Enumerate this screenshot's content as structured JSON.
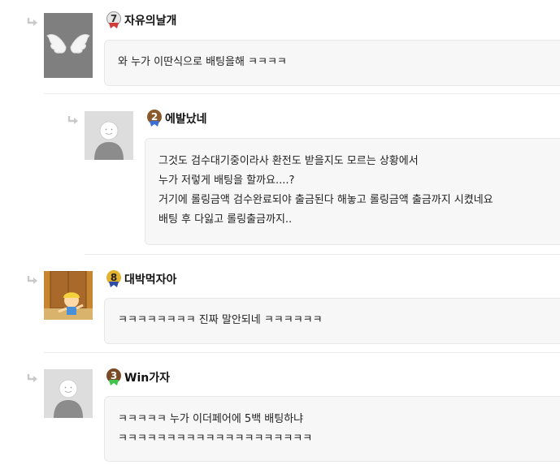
{
  "comments": [
    {
      "nickname": "자유의날개",
      "level": "7",
      "level_color": "#7b7b7b",
      "avatar": "white-wings",
      "lines": [
        "와 누가 이딴식으로 배팅을해 ㅋㅋㅋㅋ"
      ]
    },
    {
      "nickname": "에발났네",
      "level": "2",
      "level_color": "#8a5a2b",
      "avatar": "default-user",
      "lines": [
        "그것도 검수대기중이라사 환전도 받을지도 모르는 상황에서",
        "누가 저렇게 배팅을 할까요....?",
        "거기에 롤링금액 검수완료되야 출금된다 해놓고 롤링금액 출금까지 시켰네요",
        "배팅 후 다잃고 롤링출금까지.."
      ]
    },
    {
      "nickname": "대박먹자아",
      "level": "8",
      "level_color": "#c9a227",
      "avatar": "cartoon-kid",
      "lines": [
        "ㅋㅋㅋㅋㅋㅋㅋㅋ 진짜 말안되네 ㅋㅋㅋㅋㅋㅋ"
      ]
    },
    {
      "nickname": "Win가자",
      "level": "3",
      "level_color": "#7a5230",
      "avatar": "default-user",
      "lines": [
        "ㅋㅋㅋㅋㅋ 누가 이더페어에 5백 배팅하냐",
        "ㅋㅋㅋㅋㅋㅋㅋㅋㅋㅋㅋㅋㅋㅋㅋㅋㅋㅋㅋㅋ"
      ]
    }
  ]
}
